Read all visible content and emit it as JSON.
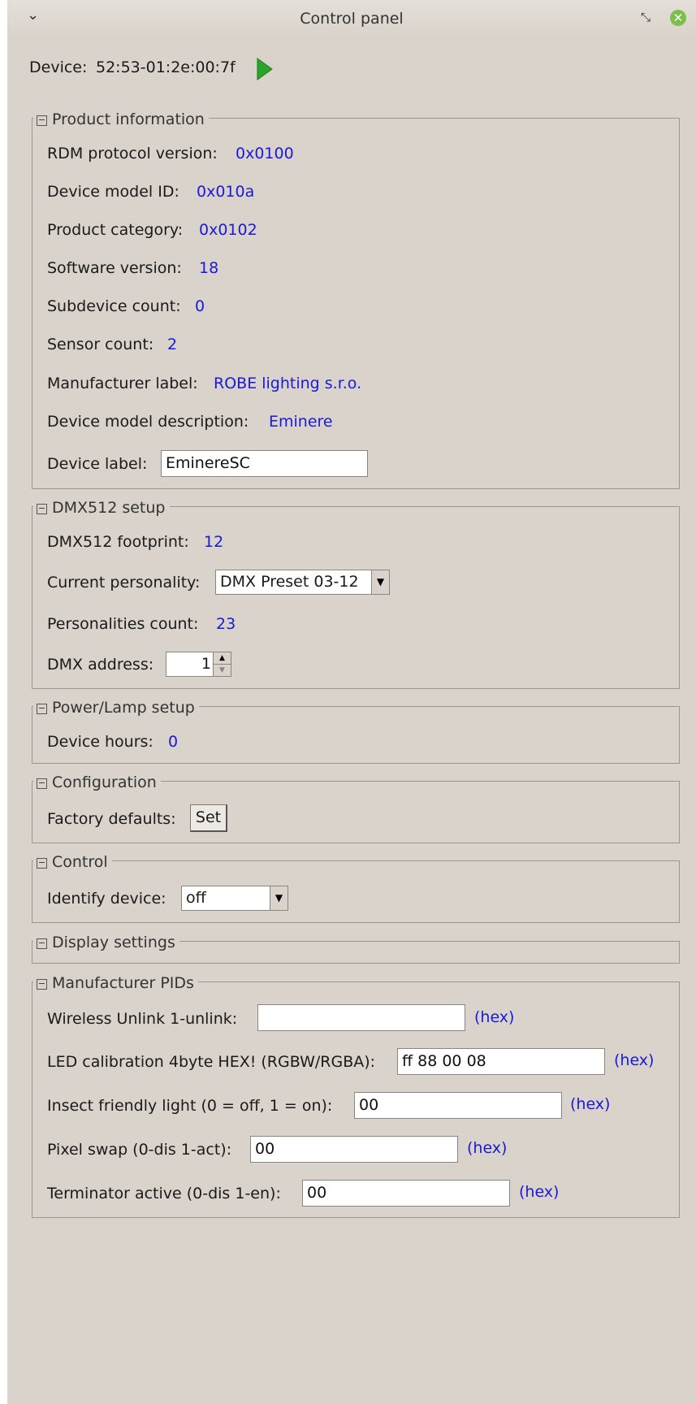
{
  "window": {
    "title": "Control panel",
    "menu_glyph": "⌄",
    "restore_glyph": "⤡",
    "close_glyph": "✕"
  },
  "device": {
    "label": "Device:",
    "id": "52:53-01:2e:00:7f",
    "play_icon": "play-icon"
  },
  "product_info": {
    "title": "Product information",
    "collapse_glyph": "−",
    "rows": [
      {
        "label": "RDM protocol version:",
        "value": "0x0100"
      },
      {
        "label": "Device model ID:",
        "value": "0x010a"
      },
      {
        "label": "Product category:",
        "value": "0x0102"
      },
      {
        "label": "Software version:",
        "value": "18"
      },
      {
        "label": "Subdevice count:",
        "value": "0"
      },
      {
        "label": "Sensor count:",
        "value": "2"
      },
      {
        "label": "Manufacturer label:",
        "value": "ROBE lighting s.r.o."
      },
      {
        "label": "Device model description:",
        "value": "Eminere"
      }
    ],
    "device_label": {
      "label": "Device label:",
      "value": "EminereSC"
    }
  },
  "dmx_setup": {
    "title": "DMX512 setup",
    "collapse_glyph": "−",
    "footprint": {
      "label": "DMX512 footprint:",
      "value": "12"
    },
    "personality": {
      "label": "Current personality:",
      "value": "DMX Preset 03-12"
    },
    "personalities_count": {
      "label": "Personalities count:",
      "value": "23"
    },
    "dmx_address": {
      "label": "DMX address:",
      "value": "1"
    }
  },
  "power_lamp": {
    "title": "Power/Lamp setup",
    "collapse_glyph": "−",
    "device_hours": {
      "label": "Device hours:",
      "value": "0"
    }
  },
  "configuration": {
    "title": "Configuration",
    "collapse_glyph": "−",
    "factory_defaults": {
      "label": "Factory defaults:",
      "button": "Set"
    }
  },
  "control": {
    "title": "Control",
    "collapse_glyph": "−",
    "identify": {
      "label": "Identify device:",
      "value": "off"
    }
  },
  "display_settings": {
    "title": "Display settings",
    "collapse_glyph": "−"
  },
  "manufacturer_pids": {
    "title": "Manufacturer PIDs",
    "collapse_glyph": "−",
    "hex_label": "(hex)",
    "rows": [
      {
        "label": "Wireless Unlink 1-unlink:",
        "value": ""
      },
      {
        "label": "LED calibration 4byte HEX! (RGBW/RGBA):",
        "value": "ff 88 00 08"
      },
      {
        "label": "Insect friendly light (0 = off, 1 = on):",
        "value": "00"
      },
      {
        "label": "Pixel swap (0-dis 1-act):",
        "value": "00"
      },
      {
        "label": "Terminator active (0-dis 1-en):",
        "value": "00"
      }
    ]
  },
  "colors": {
    "window_bg": "#d9d3cb",
    "value_blue": "#1a1ad6",
    "play_green": "#2aa52a",
    "close_green": "#7dbf4a"
  }
}
